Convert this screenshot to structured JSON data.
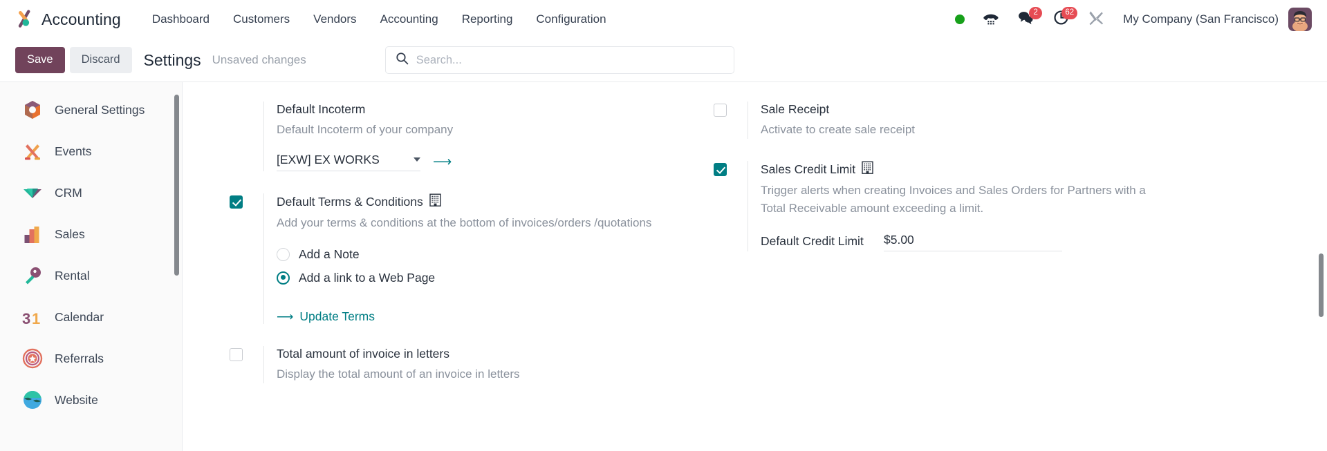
{
  "navbar": {
    "brand": "Accounting",
    "brand_logo_icon": "odoo-accounting-logo-icon",
    "menu": [
      {
        "label": "Dashboard"
      },
      {
        "label": "Customers"
      },
      {
        "label": "Vendors"
      },
      {
        "label": "Accounting"
      },
      {
        "label": "Reporting"
      },
      {
        "label": "Configuration"
      }
    ],
    "systray": {
      "presence_icon": "green-status-dot-icon",
      "presence_color": "#17a01a",
      "voip_icon": "phone-dialpad-icon",
      "messages_icon": "speech-bubbles-icon",
      "messages_count": "2",
      "activities_icon": "clock-activity-icon",
      "activities_count": "62",
      "debug_icon": "tools-wrench-screwdriver-icon",
      "badge_color": "#e64b53"
    },
    "company": "My Company (San Francisco)",
    "avatar_icon": "user-avatar-icon"
  },
  "control_panel": {
    "save_label": "Save",
    "discard_label": "Discard",
    "title": "Settings",
    "status": "Unsaved changes",
    "save_color": "#71435b"
  },
  "search": {
    "icon": "search-icon",
    "placeholder": "Search...",
    "value": ""
  },
  "sidebar": {
    "items": [
      {
        "label": "General Settings",
        "icon": "settings-gear-app-icon"
      },
      {
        "label": "Events",
        "icon": "events-app-icon"
      },
      {
        "label": "CRM",
        "icon": "crm-app-icon"
      },
      {
        "label": "Sales",
        "icon": "sales-bars-app-icon"
      },
      {
        "label": "Rental",
        "icon": "rental-key-app-icon"
      },
      {
        "label": "Calendar",
        "icon": "calendar-31-app-icon"
      },
      {
        "label": "Referrals",
        "icon": "referrals-star-app-icon"
      },
      {
        "label": "Website",
        "icon": "website-app-icon"
      }
    ]
  },
  "settings": {
    "left_column": [
      {
        "key": "default_incoterm",
        "label": "Default Incoterm",
        "help": "Default Incoterm of your company",
        "has_checkbox": false,
        "select": {
          "value": "[EXW] EX WORKS",
          "options": [
            "[EXW] EX WORKS"
          ],
          "caret_icon": "chevron-down-icon",
          "internal_link_icon": "arrow-right-icon"
        }
      },
      {
        "key": "default_terms_conditions",
        "label": "Default Terms & Conditions",
        "help": "Add your terms & conditions at the bottom of invoices/orders /quotations",
        "has_checkbox": true,
        "checked": true,
        "company_icon": "company-building-icon",
        "radios": [
          {
            "label": "Add a Note",
            "selected": false
          },
          {
            "label": "Add a link to a Web Page",
            "selected": true
          }
        ],
        "action": {
          "label": "Update Terms",
          "icon": "arrow-right-icon"
        }
      },
      {
        "key": "total_amount_in_letters",
        "label": "Total amount of invoice in letters",
        "help": "Display the total amount of an invoice in letters",
        "has_checkbox": true,
        "checked": false
      }
    ],
    "right_column": [
      {
        "key": "sale_receipt",
        "label": "Sale Receipt",
        "help": "Activate to create sale receipt",
        "has_checkbox": true,
        "checked": false
      },
      {
        "key": "sales_credit_limit",
        "label": "Sales Credit Limit",
        "help": "Trigger alerts when creating Invoices and Sales Orders for Partners with a Total Receivable amount exceeding a limit.",
        "has_checkbox": true,
        "checked": true,
        "company_icon": "company-building-icon",
        "sub_field": {
          "label": "Default Credit Limit",
          "value": "$5.00"
        }
      }
    ]
  },
  "colors": {
    "accent": "#017e84",
    "primary": "#71435b",
    "badge": "#e64b53",
    "presence": "#17a01a"
  }
}
